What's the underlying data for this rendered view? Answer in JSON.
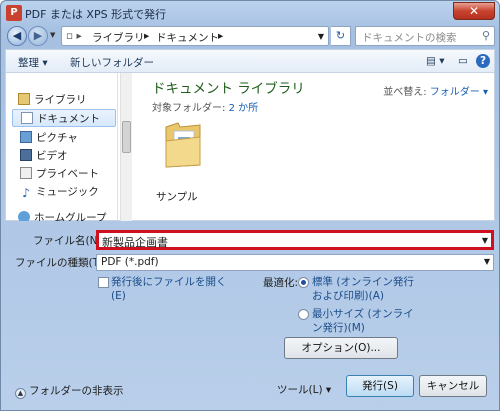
{
  "window": {
    "title": "PDF または XPS 形式で発行",
    "close_label": "✕"
  },
  "address": {
    "crumbs": [
      "ライブラリ",
      "ドキュメント"
    ],
    "search_placeholder": "ドキュメントの検索"
  },
  "toolbar": {
    "organize": "整理 ▾",
    "new_folder": "新しいフォルダー"
  },
  "nav": {
    "items": [
      "ライブラリ",
      "ドキュメント",
      "ピクチャ",
      "ビデオ",
      "プライベート",
      "ミュージック",
      "ホームグループ"
    ],
    "selected": "ドキュメント"
  },
  "content": {
    "title": "ドキュメント ライブラリ",
    "subtitle_prefix": "対象フォルダー: ",
    "subtitle_link": "2 か所",
    "arrange_label": "並べ替え:",
    "arrange_value": "フォルダー ▾",
    "files": [
      {
        "name": "サンプル"
      }
    ]
  },
  "form": {
    "filename_label": "ファイル名(N):",
    "filename_value": "新製品企画書",
    "filetype_label": "ファイルの種類(T):",
    "filetype_value": "PDF (*.pdf)",
    "open_after": "発行後にファイルを開く",
    "open_after_key": "(E)",
    "optimize_label": "最適化:",
    "opt_standard_line1": "標準 (オンライン発行",
    "opt_standard_line2": "および印刷)(A)",
    "opt_min_line1": "最小サイズ (オンライ",
    "opt_min_line2": "ン発行)(M)",
    "options_button": "オプション(O)...",
    "optimize_selected": "standard"
  },
  "footer": {
    "hide_folders": "フォルダーの非表示",
    "tools": "ツール(L) ▾",
    "publish": "発行(S)",
    "cancel": "キャンセル"
  }
}
